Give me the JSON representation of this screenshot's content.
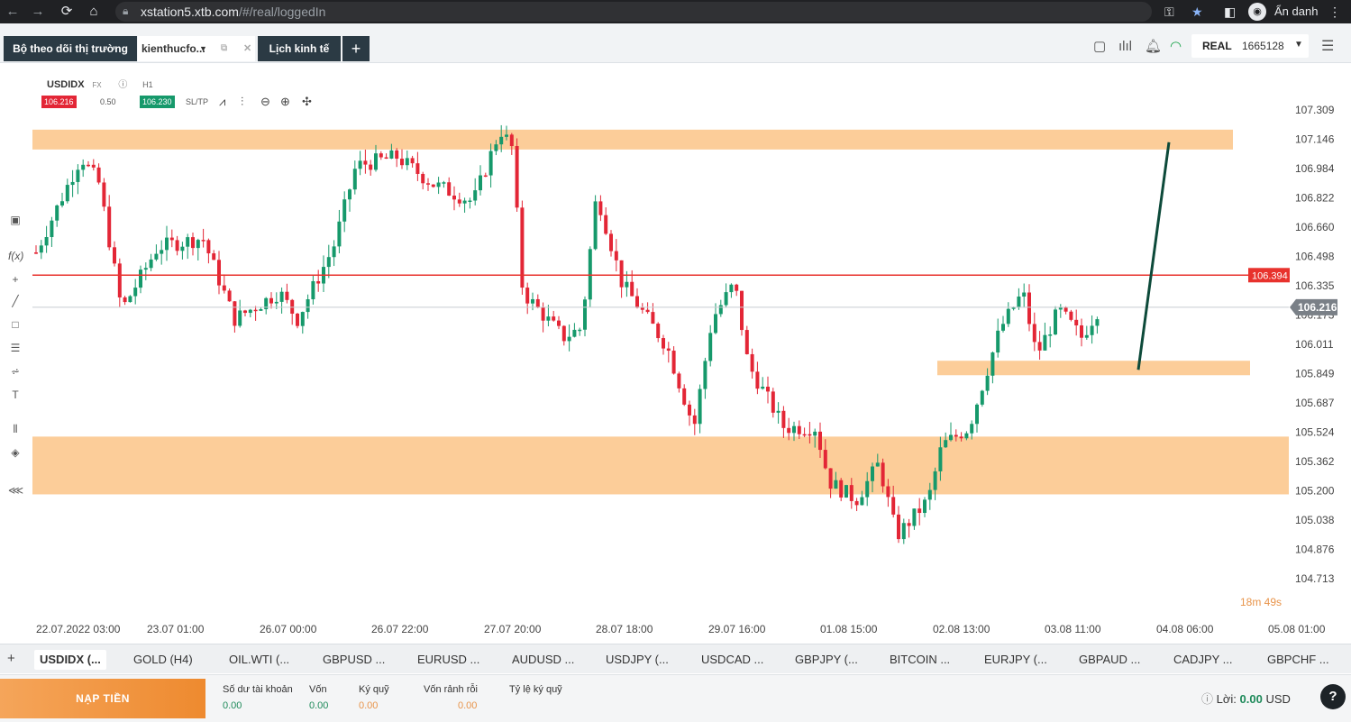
{
  "browser": {
    "url_host": "xstation5.xtb.com",
    "url_path": "/#/real/loggedIn",
    "profile_name": "Ẩn danh"
  },
  "topbar": {
    "market_watch_tab": "Bộ theo dõi thị trường",
    "selected_tab": "kienthucfo...",
    "calendar_tab": "Lịch kinh tế",
    "add_tab": "+",
    "account_type": "REAL",
    "account_number": "1665128"
  },
  "chart": {
    "symbol": "USDIDX",
    "symbol_type": "FX",
    "timeframe": "H1",
    "bid": "106.216",
    "spread": "0.50",
    "ask": "106.230",
    "sltp": "SL/TP",
    "timer": "18m 49s",
    "colors": {
      "up": "#16996b",
      "down": "#e32636",
      "zone": "#fcc487",
      "line": "#e8322d",
      "trend": "#0d4a3a"
    }
  },
  "chart_data": {
    "type": "candlestick",
    "price_labels": [
      "107.309",
      "107.146",
      "106.984",
      "106.822",
      "106.660",
      "106.498",
      "106.335",
      "106.173",
      "106.011",
      "105.849",
      "105.687",
      "105.524",
      "105.362",
      "105.200",
      "105.038",
      "104.876",
      "104.713"
    ],
    "time_labels": [
      "22.07.2022 03:00",
      "23.07 01:00",
      "26.07 00:00",
      "26.07 22:00",
      "27.07 20:00",
      "28.07 18:00",
      "29.07 16:00",
      "01.08 15:00",
      "02.08 13:00",
      "03.08 11:00",
      "04.08 06:00",
      "05.08 01:00"
    ],
    "horizontal_line": {
      "price": 106.394,
      "label": "106.394"
    },
    "current_price": {
      "price": 106.216,
      "label": "106.216"
    },
    "zones": [
      {
        "from": 107.09,
        "to": 107.2
      },
      {
        "from": 105.84,
        "to": 105.92
      },
      {
        "from": 105.18,
        "to": 105.5
      }
    ],
    "projection": {
      "from_price": 105.87,
      "to_price": 107.13
    }
  },
  "instruments": [
    "USDIDX (...",
    "GOLD (H4)",
    "OIL.WTI (...",
    "GBPUSD ...",
    "EURUSD ...",
    "AUDUSD ...",
    "USDJPY (...",
    "USDCAD ...",
    "GBPJPY (...",
    "BITCOIN ...",
    "EURJPY (...",
    "GBPAUD ...",
    "CADJPY ...",
    "GBPCHF ..."
  ],
  "bottom": {
    "deposit": "NẠP TIỀN",
    "balance_label": "Số dư tài khoản",
    "balance_value": "0.00",
    "equity_label": "Vốn",
    "equity_value": "0.00",
    "margin_label": "Ký quỹ",
    "margin_value": "0.00",
    "free_margin_label": "Vốn rảnh rỗi",
    "free_margin_value": "0.00",
    "margin_level_label": "Tỷ lệ ký quỹ",
    "profit_label": "Lời:",
    "profit_value": "0.00",
    "profit_currency": "USD"
  }
}
